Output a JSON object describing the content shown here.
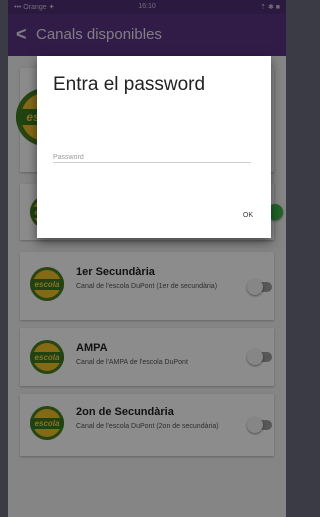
{
  "status_bar": {
    "carrier": "••• Orange ✦",
    "time": "16:10",
    "right": "⇡ ✱ ■"
  },
  "app_bar": {
    "back_icon": "chevron-left-icon",
    "title": "Canals disponibles"
  },
  "channels": [
    {
      "title": "",
      "description": "",
      "logo_text": "escola",
      "enabled": false
    },
    {
      "title": "",
      "description": "",
      "logo_text": "escola",
      "enabled": true
    },
    {
      "title": "1er Secundària",
      "description": "Canal de l'escola DuPont (1er de secundària)",
      "logo_text": "escola",
      "enabled": false
    },
    {
      "title": "AMPA",
      "description": "Canal de l'AMPA de l'escola DuPont",
      "logo_text": "escola",
      "enabled": false
    },
    {
      "title": "2on de Secundària",
      "description": "Canal de l'escola DuPont (2on de secundària)",
      "logo_text": "escola",
      "enabled": false
    }
  ],
  "dialog": {
    "title": "Entra el password",
    "password_placeholder": "Password",
    "password_value": "",
    "ok_label": "OK"
  },
  "colors": {
    "app_bar": "#5a3384",
    "status_bar": "#4f2f73",
    "toggle_on": "#3ab54a",
    "toggle_off": "#9e9e9e"
  }
}
